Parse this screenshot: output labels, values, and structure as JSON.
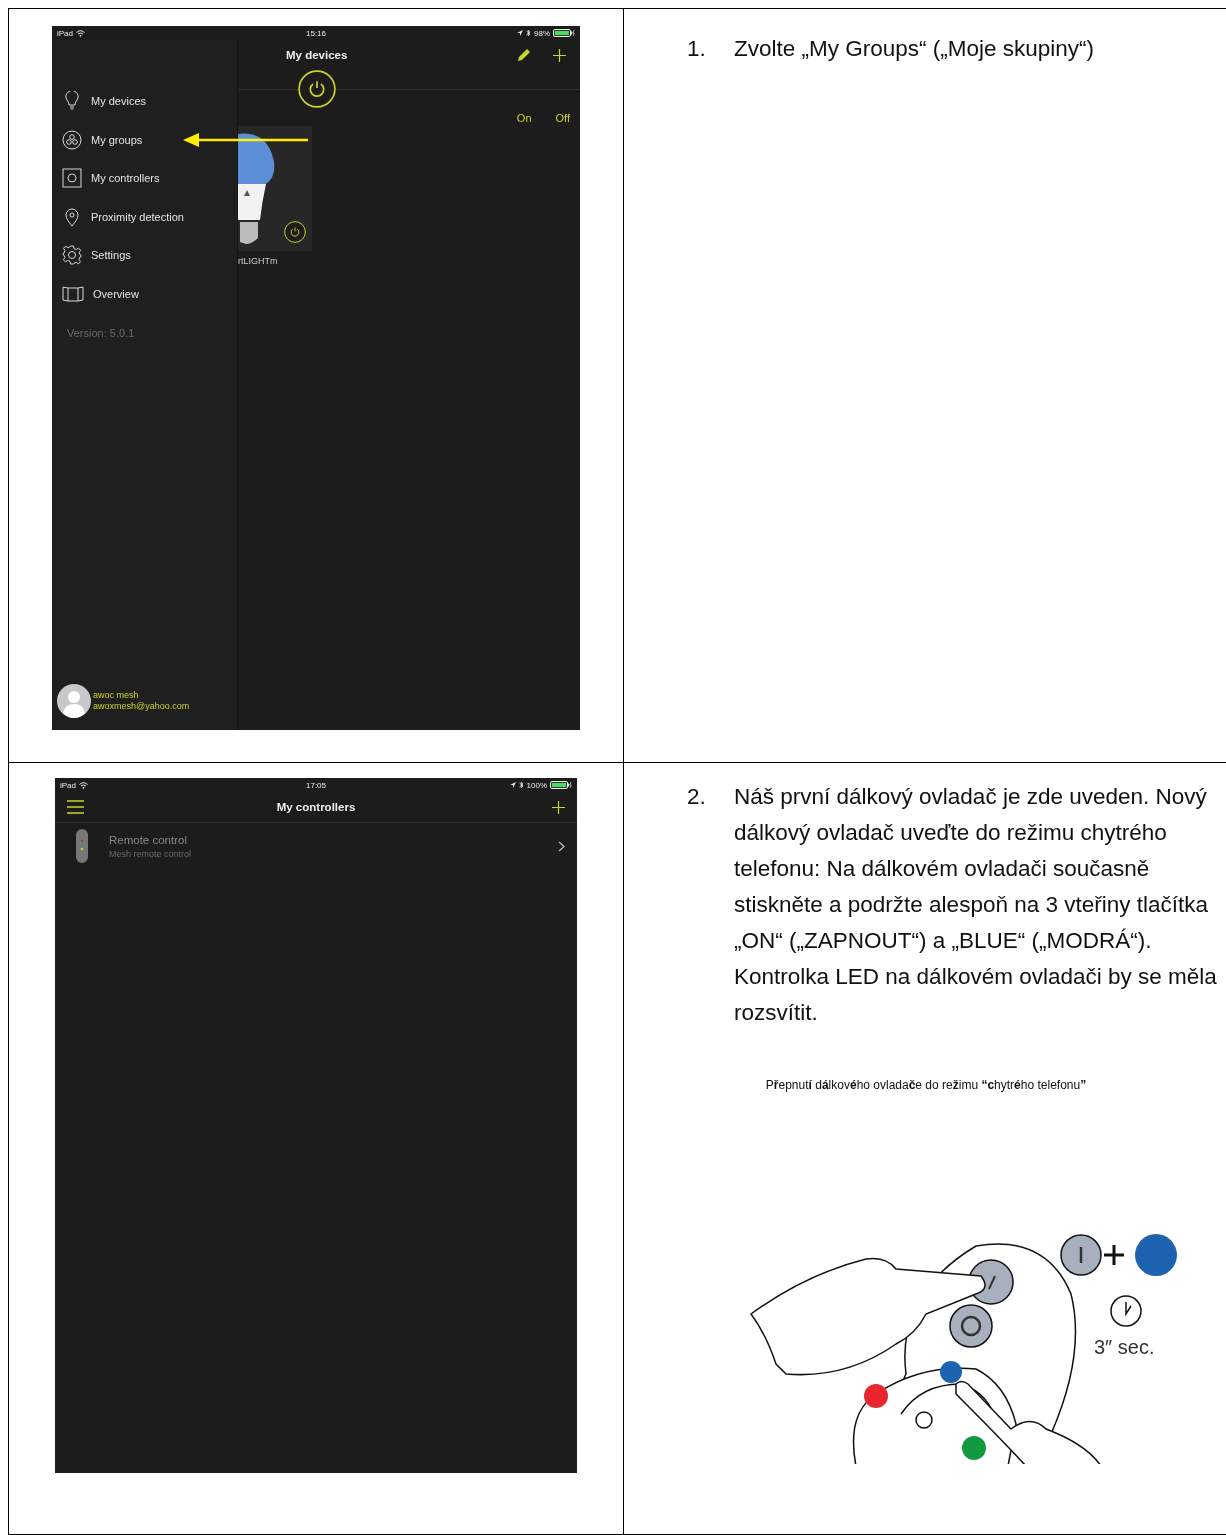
{
  "step_1": {
    "number": "1.",
    "text": "Zvolte „My Groups“ („Moje skupiny“)",
    "screen": {
      "status_bar": {
        "carrier": "iPad",
        "time": "15:16",
        "battery": "98%"
      },
      "title": "My devices",
      "menu": [
        {
          "label": "My devices",
          "kind": "bulb",
          "pointed": false
        },
        {
          "label": "My groups",
          "kind": "groups",
          "pointed": true
        },
        {
          "label": "My controllers",
          "kind": "controller",
          "pointed": false
        },
        {
          "label": "Proximity detection",
          "kind": "pin",
          "pointed": false
        },
        {
          "label": "Settings",
          "kind": "gear",
          "pointed": false
        },
        {
          "label": "Overview",
          "kind": "map",
          "pointed": false
        }
      ],
      "version": "Version: 5.0.1",
      "user": {
        "name": "awoc mesh",
        "email": "awoxmesh@yahoo.com"
      },
      "on_label": "On",
      "off_label": "Off",
      "device": {
        "label": "rtLIGHTm"
      }
    }
  },
  "step_2": {
    "number": "2.",
    "text": "Náš první dálkový ovladač je zde uveden. Nový dálkový ovladač uveďte do režimu chytrého telefonu: Na dálkovém ovladači současně stiskněte a podržte alespoň na 3 vteřiny tlačítka „ON“ („ZAPNOUT“) a „BLUE“ („MODRÁ“). Kontrolka LED na dálkovém ovladači by se měla rozsvítit.",
    "screen": {
      "status_bar": {
        "carrier": "iPad",
        "time": "17:05",
        "battery": "100%"
      },
      "title": "My controllers",
      "controllers": [
        {
          "name": "Remote control",
          "subtitle": "Mesh remote control"
        }
      ]
    },
    "figure": {
      "caption": "P**ř**epnut**í** d**á**lkov**é**ho ovlada**č**e do re**ž**imu **“c**hytr**é**ho telefonu**”**",
      "duration": "3″ sec."
    }
  }
}
